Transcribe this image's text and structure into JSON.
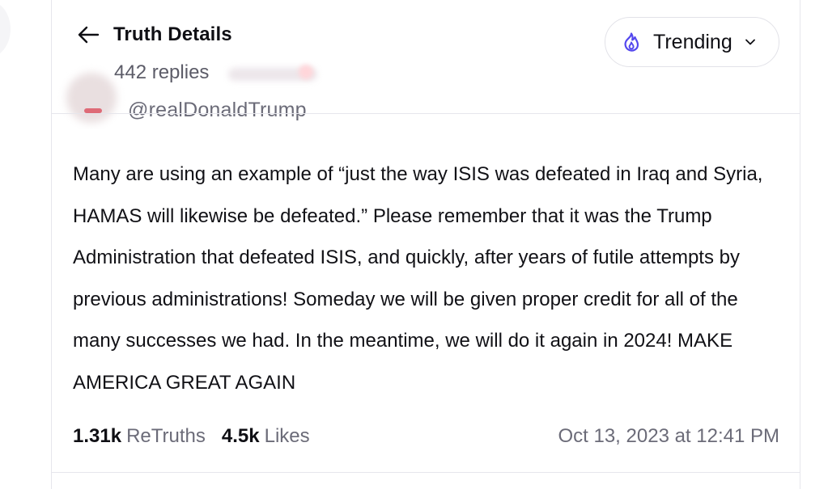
{
  "header": {
    "title": "Truth Details",
    "reply_count": "442 replies",
    "back_icon": "arrow-left-icon",
    "sort": {
      "label": "Trending",
      "icon": "flame-icon",
      "chevron": "chevron-down-icon",
      "accent_color": "#5448ee"
    }
  },
  "author": {
    "handle": "@realDonaldTrump"
  },
  "post": {
    "text": "Many are using an example of “just the way ISIS was defeated in Iraq and Syria, HAMAS will likewise be defeated.” Please remember that it was the Trump Administration that defeated ISIS, and quickly, after years of futile attempts by previous administrations! Someday we will be given proper credit for all of the many successes we had. In the meantime, we will do it again in 2024! MAKE AMERICA GREAT AGAIN",
    "retruths_count": "1.31k",
    "retruths_label": "ReTruths",
    "likes_count": "4.5k",
    "likes_label": "Likes",
    "timestamp": "Oct 13, 2023 at 12:41 PM"
  }
}
